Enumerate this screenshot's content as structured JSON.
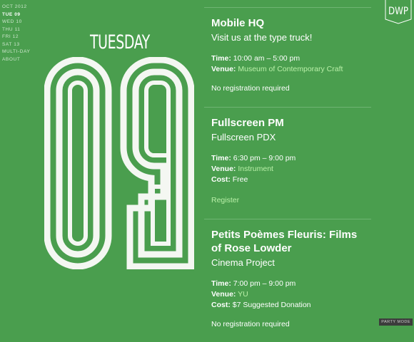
{
  "nav": [
    {
      "label": "OCT 2012",
      "active": false
    },
    {
      "label": "TUE 09",
      "active": true
    },
    {
      "label": "WED 10",
      "active": false
    },
    {
      "label": "THU 11",
      "active": false
    },
    {
      "label": "FRI 12",
      "active": false
    },
    {
      "label": "SAT 13",
      "active": false
    },
    {
      "label": "MULTI-DAY",
      "active": false
    },
    {
      "label": "ABOUT",
      "active": false
    }
  ],
  "day": {
    "name": "TUESDAY",
    "number": "09"
  },
  "logo": {
    "text": "DWP"
  },
  "events": [
    {
      "title": "Mobile HQ",
      "subtitle": "Visit us at the type truck!",
      "time_label": "Time:",
      "time": "10:00 am – 5:00 pm",
      "venue_label": "Venue:",
      "venue": "Museum of Contemporary Craft",
      "note": "No registration required"
    },
    {
      "title": "Fullscreen PM",
      "subtitle": "Fullscreen PDX",
      "time_label": "Time:",
      "time": "6:30 pm – 9:00 pm",
      "venue_label": "Venue:",
      "venue": "Instrument",
      "cost_label": "Cost:",
      "cost": "Free",
      "register": "Register"
    },
    {
      "title": "Petits Poèmes Fleuris: Films of Rose Lowder",
      "subtitle": "Cinema Project",
      "time_label": "Time:",
      "time": "7:00 pm – 9:00 pm",
      "venue_label": "Venue:",
      "venue": "YU",
      "cost_label": "Cost:",
      "cost": "$7 Suggested Donation",
      "note": "No registration required"
    }
  ],
  "party_mode": "PARTY MODE",
  "colors": {
    "background": "#4a9e4e",
    "link": "#b9f0a8",
    "text": "#ffffff"
  }
}
